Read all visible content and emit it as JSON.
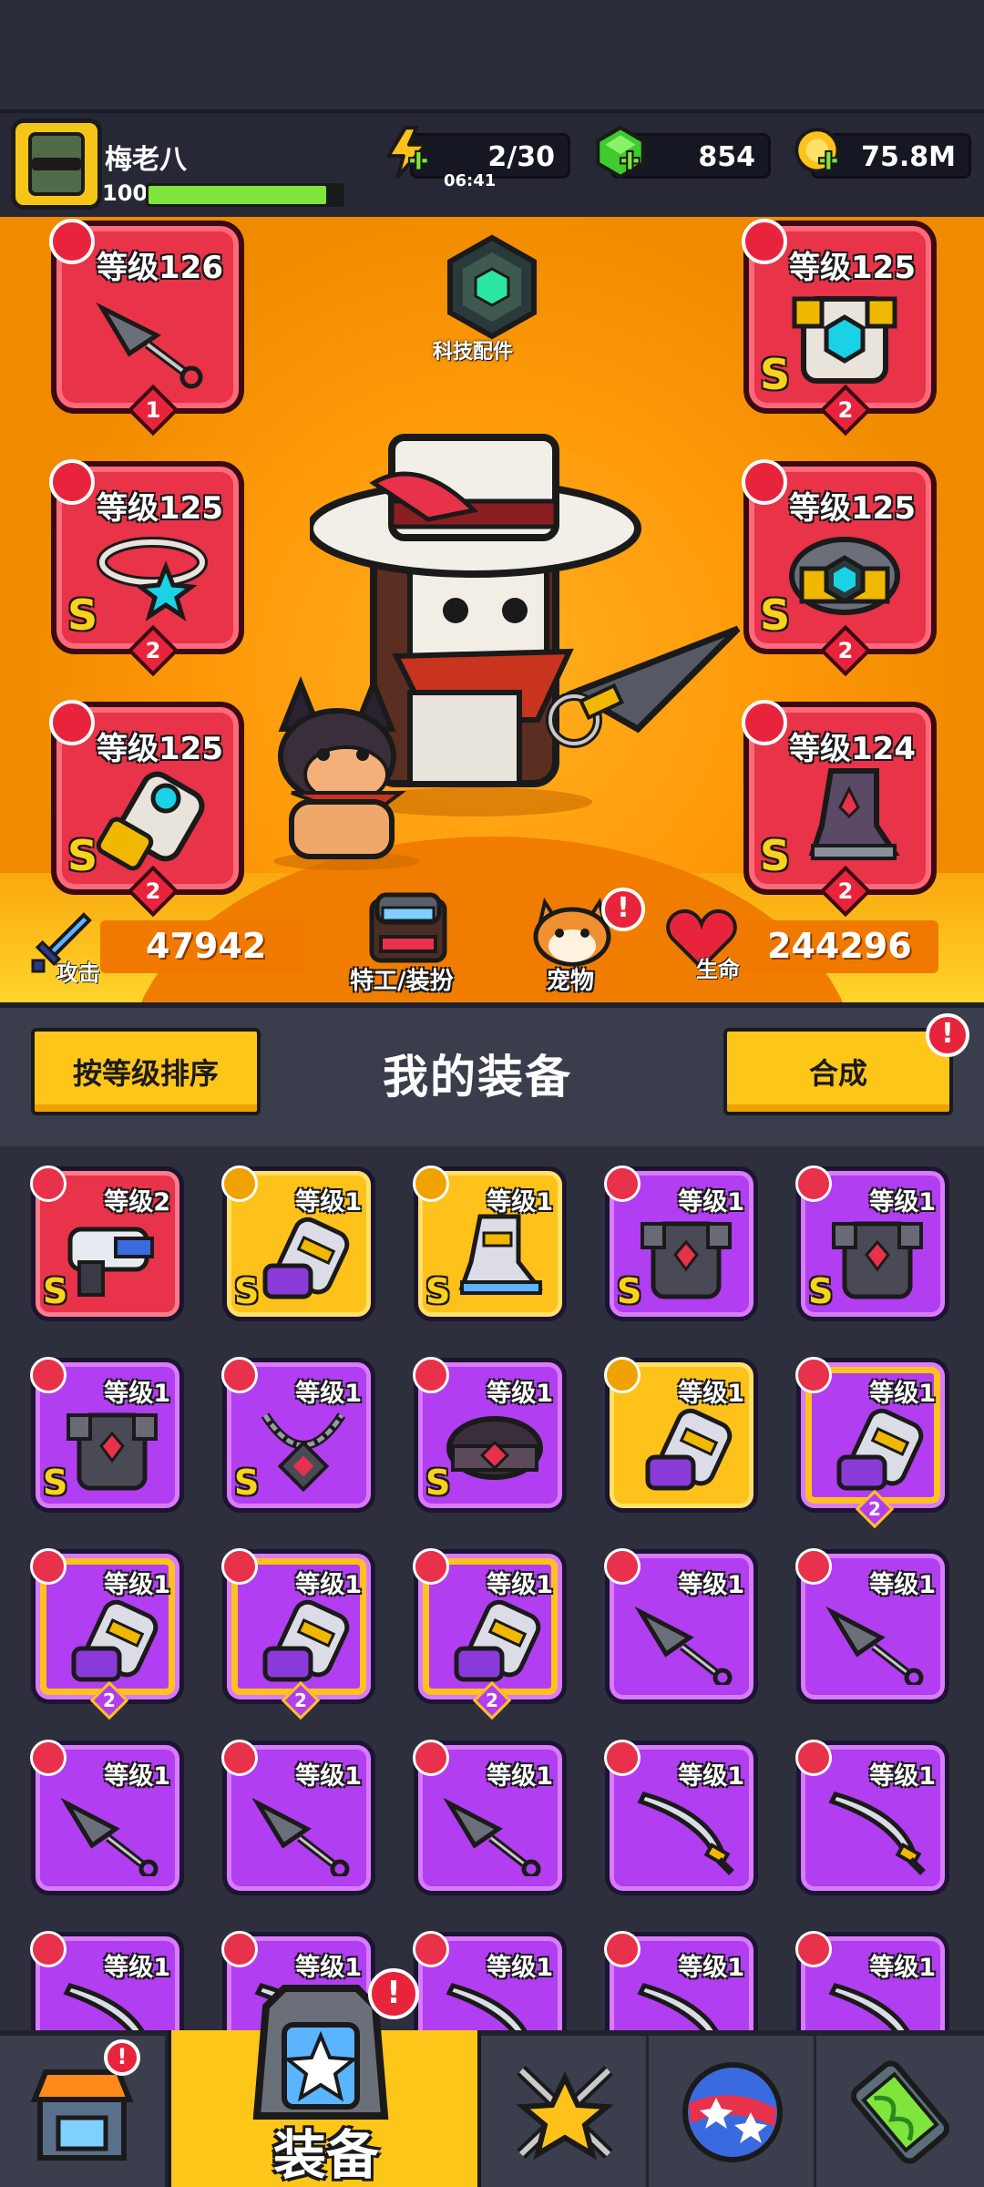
{
  "player": {
    "name": "梅老八",
    "level": "100",
    "xp_fraction": 0.92
  },
  "resources": {
    "energy": {
      "value": "2/30",
      "timer": "06:41",
      "icon": "lightning-icon"
    },
    "gems": {
      "value": "854",
      "icon": "green-gem-icon"
    },
    "gold": {
      "value": "75.8M",
      "icon": "gold-coin-icon"
    }
  },
  "tech_parts": {
    "label": "科技配件",
    "icon": "hexagon-chip-icon"
  },
  "equipped": [
    {
      "slot": "weapon",
      "level_text": "等级126",
      "grade": "",
      "stars": "1",
      "icon": "kunai-icon",
      "type_icon": "weapon-type-icon"
    },
    {
      "slot": "armor",
      "level_text": "等级125",
      "grade": "S",
      "stars": "2",
      "icon": "armor-icon",
      "type_icon": "armor-type-icon"
    },
    {
      "slot": "necklace",
      "level_text": "等级125",
      "grade": "S",
      "stars": "2",
      "icon": "necklace-icon",
      "type_icon": "necklace-type-icon"
    },
    {
      "slot": "belt",
      "level_text": "等级125",
      "grade": "S",
      "stars": "2",
      "icon": "belt-icon",
      "type_icon": "belt-type-icon"
    },
    {
      "slot": "gloves",
      "level_text": "等级125",
      "grade": "S",
      "stars": "2",
      "icon": "gauntlet-icon",
      "type_icon": "glove-type-icon"
    },
    {
      "slot": "boots",
      "level_text": "等级124",
      "grade": "S",
      "stars": "2",
      "icon": "boots-icon",
      "type_icon": "boots-type-icon"
    }
  ],
  "stats": {
    "attack": {
      "label": "攻击",
      "value": "47942"
    },
    "hp": {
      "label": "生命",
      "value": "244296"
    }
  },
  "center_buttons": {
    "agent_outfit": "特工/装扮",
    "pet": "宠物"
  },
  "toolbar": {
    "sort_label": "按等级排序",
    "title": "我的装备",
    "merge_label": "合成",
    "merge_alert": "!",
    "pet_alert": "!"
  },
  "inventory": [
    {
      "level_text": "等级2",
      "grade": "S",
      "rarity": "red",
      "icon": "blaster-icon",
      "stars": ""
    },
    {
      "level_text": "等级1",
      "grade": "S",
      "rarity": "yellow",
      "icon": "gauntlet-icon",
      "stars": ""
    },
    {
      "level_text": "等级1",
      "grade": "S",
      "rarity": "yellow",
      "icon": "boots-icon",
      "stars": ""
    },
    {
      "level_text": "等级1",
      "grade": "S",
      "rarity": "purple",
      "icon": "armor-icon",
      "stars": ""
    },
    {
      "level_text": "等级1",
      "grade": "S",
      "rarity": "purple",
      "icon": "armor-icon",
      "stars": ""
    },
    {
      "level_text": "等级1",
      "grade": "S",
      "rarity": "purple",
      "icon": "armor-icon",
      "stars": ""
    },
    {
      "level_text": "等级1",
      "grade": "S",
      "rarity": "purple",
      "icon": "necklace-icon",
      "stars": ""
    },
    {
      "level_text": "等级1",
      "grade": "S",
      "rarity": "purple",
      "icon": "belt-icon",
      "stars": ""
    },
    {
      "level_text": "等级1",
      "grade": "",
      "rarity": "yellow",
      "icon": "gauntlet-icon",
      "stars": ""
    },
    {
      "level_text": "等级1",
      "grade": "",
      "rarity": "purple-framed",
      "icon": "gauntlet-icon",
      "stars": "2"
    },
    {
      "level_text": "等级1",
      "grade": "",
      "rarity": "purple-framed",
      "icon": "gauntlet-icon",
      "stars": "2"
    },
    {
      "level_text": "等级1",
      "grade": "",
      "rarity": "purple-framed",
      "icon": "gauntlet-icon",
      "stars": "2"
    },
    {
      "level_text": "等级1",
      "grade": "",
      "rarity": "purple-framed",
      "icon": "gauntlet-icon",
      "stars": "2"
    },
    {
      "level_text": "等级1",
      "grade": "",
      "rarity": "purple",
      "icon": "kunai-icon",
      "stars": ""
    },
    {
      "level_text": "等级1",
      "grade": "",
      "rarity": "purple",
      "icon": "kunai-icon",
      "stars": ""
    },
    {
      "level_text": "等级1",
      "grade": "",
      "rarity": "purple",
      "icon": "kunai-icon",
      "stars": ""
    },
    {
      "level_text": "等级1",
      "grade": "",
      "rarity": "purple",
      "icon": "kunai-icon",
      "stars": ""
    },
    {
      "level_text": "等级1",
      "grade": "",
      "rarity": "purple",
      "icon": "kunai-icon",
      "stars": ""
    },
    {
      "level_text": "等级1",
      "grade": "",
      "rarity": "purple",
      "icon": "katana-icon",
      "stars": ""
    },
    {
      "level_text": "等级1",
      "grade": "",
      "rarity": "purple",
      "icon": "katana-icon",
      "stars": ""
    },
    {
      "level_text": "等级1",
      "grade": "",
      "rarity": "purple",
      "icon": "katana-icon",
      "stars": ""
    },
    {
      "level_text": "等级1",
      "grade": "",
      "rarity": "purple",
      "icon": "katana-icon",
      "stars": ""
    },
    {
      "level_text": "等级1",
      "grade": "",
      "rarity": "purple",
      "icon": "katana-icon",
      "stars": ""
    },
    {
      "level_text": "等级1",
      "grade": "",
      "rarity": "purple",
      "icon": "katana-icon",
      "stars": ""
    },
    {
      "level_text": "等级1",
      "grade": "",
      "rarity": "purple",
      "icon": "katana-icon",
      "stars": ""
    }
  ],
  "nav": [
    {
      "name": "nav-shop",
      "icon": "shop-icon",
      "alert": "!"
    },
    {
      "name": "nav-equipment",
      "label": "装备",
      "icon": "backpack-icon",
      "alert": "!",
      "active": true
    },
    {
      "name": "nav-battle",
      "icon": "crossed-swords-star-icon"
    },
    {
      "name": "nav-talents",
      "icon": "star-orb-icon"
    },
    {
      "name": "nav-evolve",
      "icon": "dna-capsule-icon"
    }
  ],
  "colors": {
    "rarity_purple": "#b13ef0",
    "rarity_yellow": "#ffc21a",
    "rarity_red": "#e8334a",
    "accent_orange": "#ff9a0a"
  }
}
